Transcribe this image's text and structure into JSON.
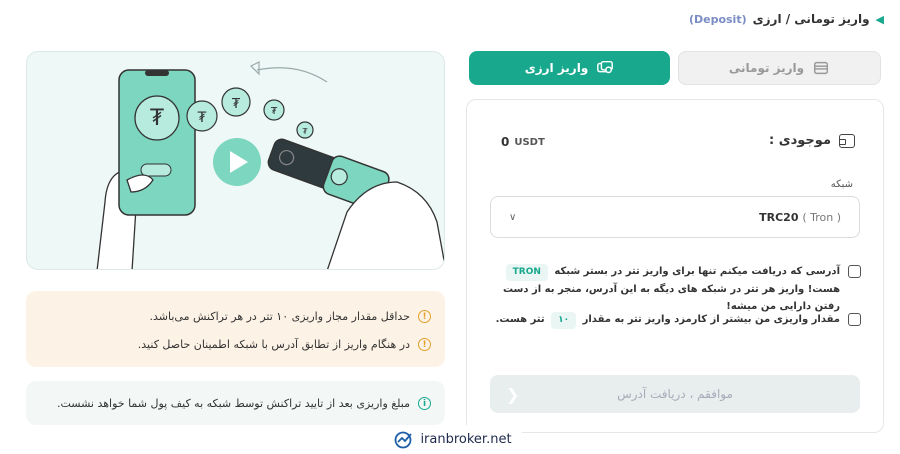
{
  "breadcrumb": {
    "title": "واریز تومانی / ارزی",
    "tag": "(Deposit)"
  },
  "tabs": [
    {
      "label": "واریز ارزی",
      "icon": "card-stack-icon",
      "active": true
    },
    {
      "label": "واریز تومانی",
      "icon": "card-icon",
      "active": false
    }
  ],
  "balance": {
    "label": "موجودی :",
    "value": "0",
    "unit": "USDT"
  },
  "network": {
    "label": "شبکه",
    "selected_main": "TRC20",
    "selected_sub": "( Tron )"
  },
  "checks": {
    "c1_part1": "آدرسی که دریافت میکنم تنها برای واریز تتر در بستر شبکه",
    "c1_pill": "TRON",
    "c1_part2": "هست! واریز هر تتر در شبکه های دیگه به این آدرس، منجر به از دست رفتن دارایی من میشه!",
    "c2_part1": "مقدار واریزی من بیشتر از کارمزد واریز تتر به مقدار",
    "c2_pill": "۱۰",
    "c2_part2": "تتر هست."
  },
  "submit_label": "موافقم ، دریافت آدرس",
  "warnings": [
    "حداقل مقدار مجاز واریزی ۱۰ تتر در هر تراکنش می‌باشد.",
    "در هنگام واریز از تطابق آدرس با شبکه اطمینان حاصل کنید."
  ],
  "info": "مبلغ واریزی بعد از تایید تراکنش توسط شبکه به کیف پول شما خواهد نشست.",
  "watermark": "iranbroker.net",
  "colors": {
    "accent": "#17a88e",
    "warning_bg": "#fdf2e6",
    "info_bg": "#f3f8f7"
  }
}
